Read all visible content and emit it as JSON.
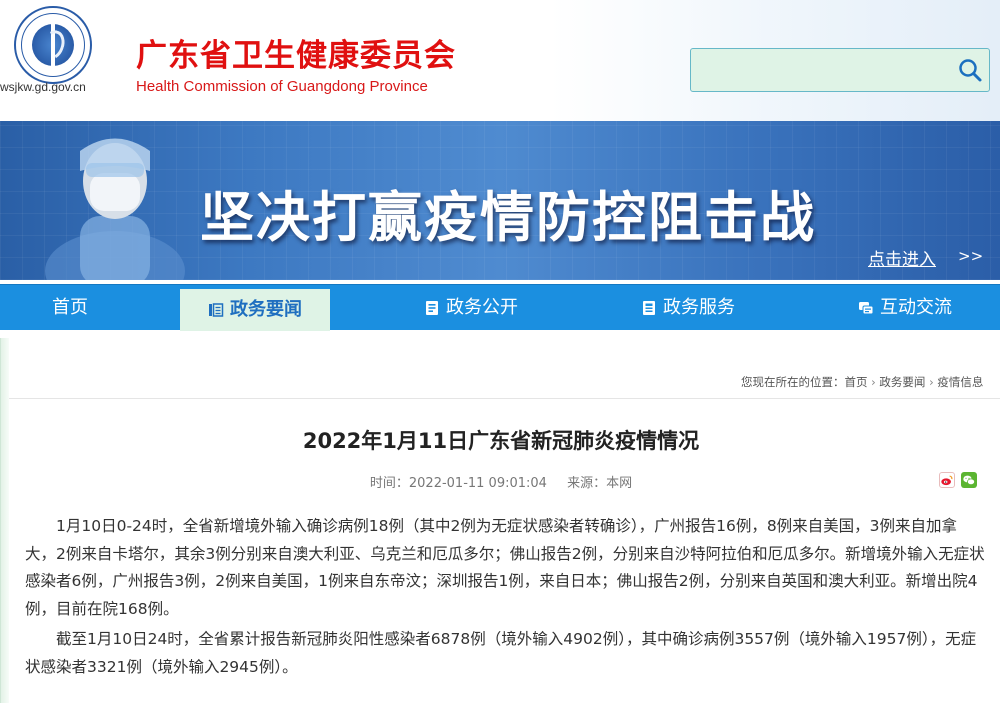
{
  "header": {
    "domain": "wsjkw.gd.gov.cn",
    "title_cn": "广东省卫生健康委员会",
    "title_en": "Health Commission of Guangdong Province",
    "search": {
      "placeholder": "",
      "value": ""
    }
  },
  "banner": {
    "title": "坚决打赢疫情防控阻击战",
    "enter_link": "点击进入",
    "enter_arrows": ">>"
  },
  "nav": {
    "items": [
      {
        "label": "首页",
        "icon": ""
      },
      {
        "label": "政务要闻",
        "icon": "news-icon",
        "active": true
      },
      {
        "label": "政务公开",
        "icon": "document-icon"
      },
      {
        "label": "政务服务",
        "icon": "service-icon"
      },
      {
        "label": "互动交流",
        "icon": "interaction-icon"
      }
    ]
  },
  "breadcrumb": {
    "prefix": "您现在所在的位置：",
    "items": [
      "首页",
      "政务要闻",
      "疫情信息"
    ]
  },
  "article": {
    "title": "2022年1月11日广东省新冠肺炎疫情情况",
    "time_label": "时间：2022-01-11 09:01:04",
    "source_label": "来源：本网",
    "paragraphs": [
      "1月10日0-24时，全省新增境外输入确诊病例18例（其中2例为无症状感染者转确诊），广州报告16例，8例来自美国，3例来自加拿大，2例来自卡塔尔，其余3例分别来自澳大利亚、乌克兰和厄瓜多尔；佛山报告2例，分别来自沙特阿拉伯和厄瓜多尔。新增境外输入无症状感染者6例，广州报告3例，2例来自美国，1例来自东帝汶；深圳报告1例，来自日本；佛山报告2例，分别来自英国和澳大利亚。新增出院4例，目前在院168例。",
      "截至1月10日24时，全省累计报告新冠肺炎阳性感染者6878例（境外输入4902例），其中确诊病例3557例（境外输入1957例），无症状感染者3321例（境外输入2945例）。"
    ]
  },
  "colors": {
    "brand_red": "#e01010",
    "nav_blue": "#1b8fe0",
    "active_tab_bg": "#dff3e6",
    "active_tab_text": "#1f6fc0"
  }
}
